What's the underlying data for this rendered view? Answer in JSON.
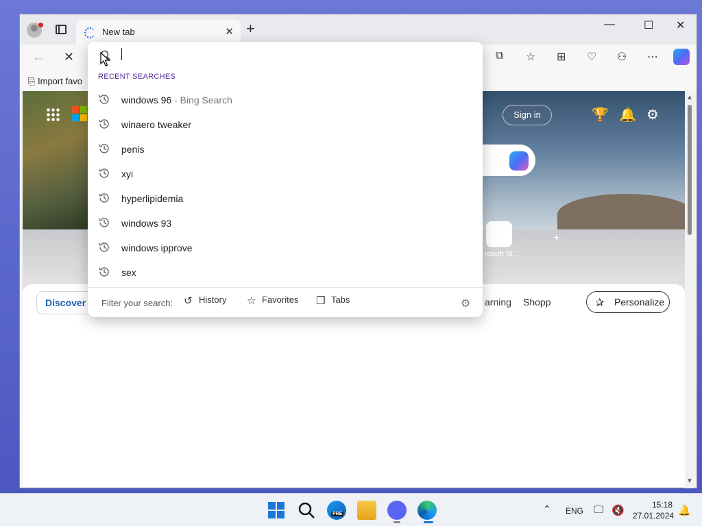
{
  "browser": {
    "tab_title": "New tab",
    "window_controls": {
      "minimize": "—",
      "maximize": "☐",
      "close": "✕"
    }
  },
  "favorites_bar": {
    "import_label": "Import favo"
  },
  "page": {
    "sign_in": "Sign in",
    "tile_label": "rosoft St...",
    "feed_tabs": {
      "discover": "Discover",
      "learning": "arning",
      "shopping": "Shopp"
    },
    "personalize": "Personalize"
  },
  "dropdown": {
    "heading": "RECENT SEARCHES",
    "items": [
      {
        "text": "windows 96",
        "suffix": " - Bing Search"
      },
      {
        "text": "winaero tweaker",
        "suffix": ""
      },
      {
        "text": "penis",
        "suffix": ""
      },
      {
        "text": "xyi",
        "suffix": ""
      },
      {
        "text": "hyperlipidemia",
        "suffix": ""
      },
      {
        "text": "windows 93",
        "suffix": ""
      },
      {
        "text": "windows ipprove",
        "suffix": ""
      },
      {
        "text": "sex",
        "suffix": ""
      }
    ],
    "filter": {
      "label": "Filter your search:",
      "history": "History",
      "favorites": "Favorites",
      "tabs": "Tabs"
    }
  },
  "taskbar": {
    "language": "ENG",
    "time": "15:18",
    "date": "27.01.2024",
    "edge_badge": "PRE"
  },
  "colors": {
    "accent_purple": "#5a2ca0",
    "discover_blue": "#1a5fb4",
    "desktop": "#5a66c8"
  }
}
